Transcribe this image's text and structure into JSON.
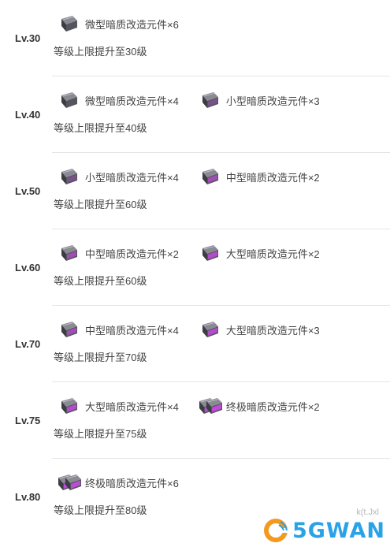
{
  "rows": [
    {
      "level": "Lv.30",
      "items": [
        {
          "label": "微型暗质改造元件×6",
          "icon": "micro-dark-component-icon",
          "tier": 0
        }
      ],
      "desc": "等级上限提升至30级"
    },
    {
      "level": "Lv.40",
      "items": [
        {
          "label": "微型暗质改造元件×4",
          "icon": "micro-dark-component-icon",
          "tier": 0
        },
        {
          "label": "小型暗质改造元件×3",
          "icon": "small-dark-component-icon",
          "tier": 1
        }
      ],
      "desc": "等级上限提升至40级"
    },
    {
      "level": "Lv.50",
      "items": [
        {
          "label": "小型暗质改造元件×4",
          "icon": "small-dark-component-icon",
          "tier": 1
        },
        {
          "label": "中型暗质改造元件×2",
          "icon": "medium-dark-component-icon",
          "tier": 2
        }
      ],
      "desc": "等级上限提升至60级"
    },
    {
      "level": "Lv.60",
      "items": [
        {
          "label": "中型暗质改造元件×2",
          "icon": "medium-dark-component-icon",
          "tier": 2
        },
        {
          "label": "大型暗质改造元件×2",
          "icon": "large-dark-component-icon",
          "tier": 3
        }
      ],
      "desc": "等级上限提升至60级"
    },
    {
      "level": "Lv.70",
      "items": [
        {
          "label": "中型暗质改造元件×4",
          "icon": "medium-dark-component-icon",
          "tier": 2
        },
        {
          "label": "大型暗质改造元件×3",
          "icon": "large-dark-component-icon",
          "tier": 3
        }
      ],
      "desc": "等级上限提升至70级"
    },
    {
      "level": "Lv.75",
      "items": [
        {
          "label": "大型暗质改造元件×4",
          "icon": "large-dark-component-icon",
          "tier": 3
        },
        {
          "label": "终极暗质改造元件×2",
          "icon": "ultimate-dark-component-icon",
          "tier": 4
        }
      ],
      "desc": "等级上限提升至75级"
    },
    {
      "level": "Lv.80",
      "items": [
        {
          "label": "终极暗质改造元件×6",
          "icon": "ultimate-dark-component-icon",
          "tier": 4
        }
      ],
      "desc": "等级上限提升至80级"
    }
  ],
  "watermark": {
    "text": "5GWAN",
    "icon": "5gwan-logo-icon",
    "color": "#2aa2e8"
  },
  "colors": {
    "metal": "#4a4a52",
    "metal_light": "#8a8a94",
    "glow": "#c04ad8"
  }
}
